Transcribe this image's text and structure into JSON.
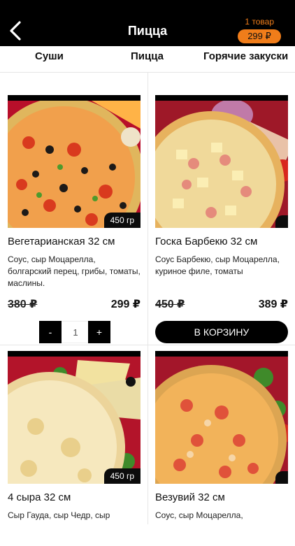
{
  "header": {
    "title": "Пицца",
    "cart_count": "1 товар",
    "cart_total": "299 ₽"
  },
  "tabs": [
    "Суши",
    "Пицца",
    "Горячие закуски"
  ],
  "products": [
    {
      "name": "Вегетарианская 32 см",
      "description": "Соус, сыр Моцарелла, болгарский перец, грибы, томаты, маслины.",
      "weight": "450 гр",
      "old_price": "380 ₽",
      "price": "299 ₽",
      "quantity": "1",
      "minus_label": "-",
      "plus_label": "+"
    },
    {
      "name": "Госка Барбекю 32 см",
      "description": "Соус Барбекю, сыр Моцарелла, куриное филе, томаты",
      "old_price": "450 ₽",
      "price": "389 ₽",
      "cart_button": "В КОРЗИНУ"
    },
    {
      "name": "4 сыра 32 см",
      "description": "Сыр Гауда, сыр Чедр, сыр",
      "weight": "450 гр"
    },
    {
      "name": "Везувий 32 см",
      "description": "Соус, сыр Моцарелла,"
    }
  ]
}
